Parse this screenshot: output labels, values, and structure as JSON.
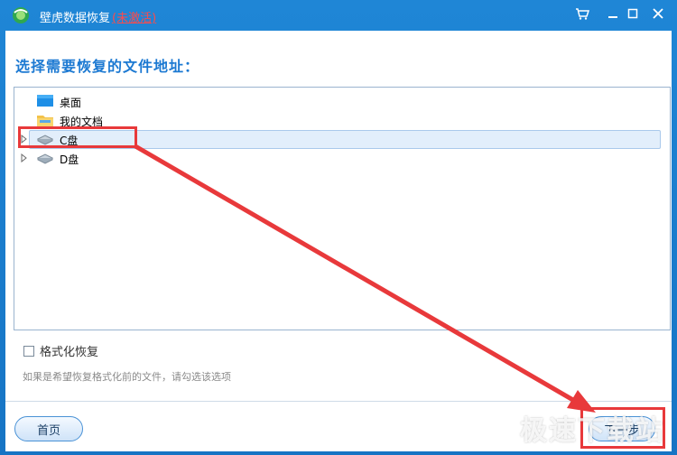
{
  "window": {
    "title": "壁虎数据恢复",
    "unregistered_label": "(未激活)"
  },
  "main": {
    "heading": "选择需要恢复的文件地址：",
    "tree": [
      {
        "label": "桌面",
        "icon": "desktop-icon",
        "expandable": false
      },
      {
        "label": "我的文档",
        "icon": "folder-icon",
        "expandable": false
      },
      {
        "label": "C盘",
        "icon": "drive-icon",
        "expandable": true,
        "selected": true
      },
      {
        "label": "D盘",
        "icon": "drive-icon",
        "expandable": true
      }
    ],
    "format_recover_label": "格式化恢复",
    "hint": "如果是希望恢复格式化前的文件，请勾选该选项"
  },
  "footer": {
    "home_label": "首页",
    "next_label": "下一步"
  },
  "watermark": "极速下载站",
  "colors": {
    "accent": "#1c79d2",
    "annotation": "#e8393b",
    "selected_row": "#e2eefb"
  }
}
